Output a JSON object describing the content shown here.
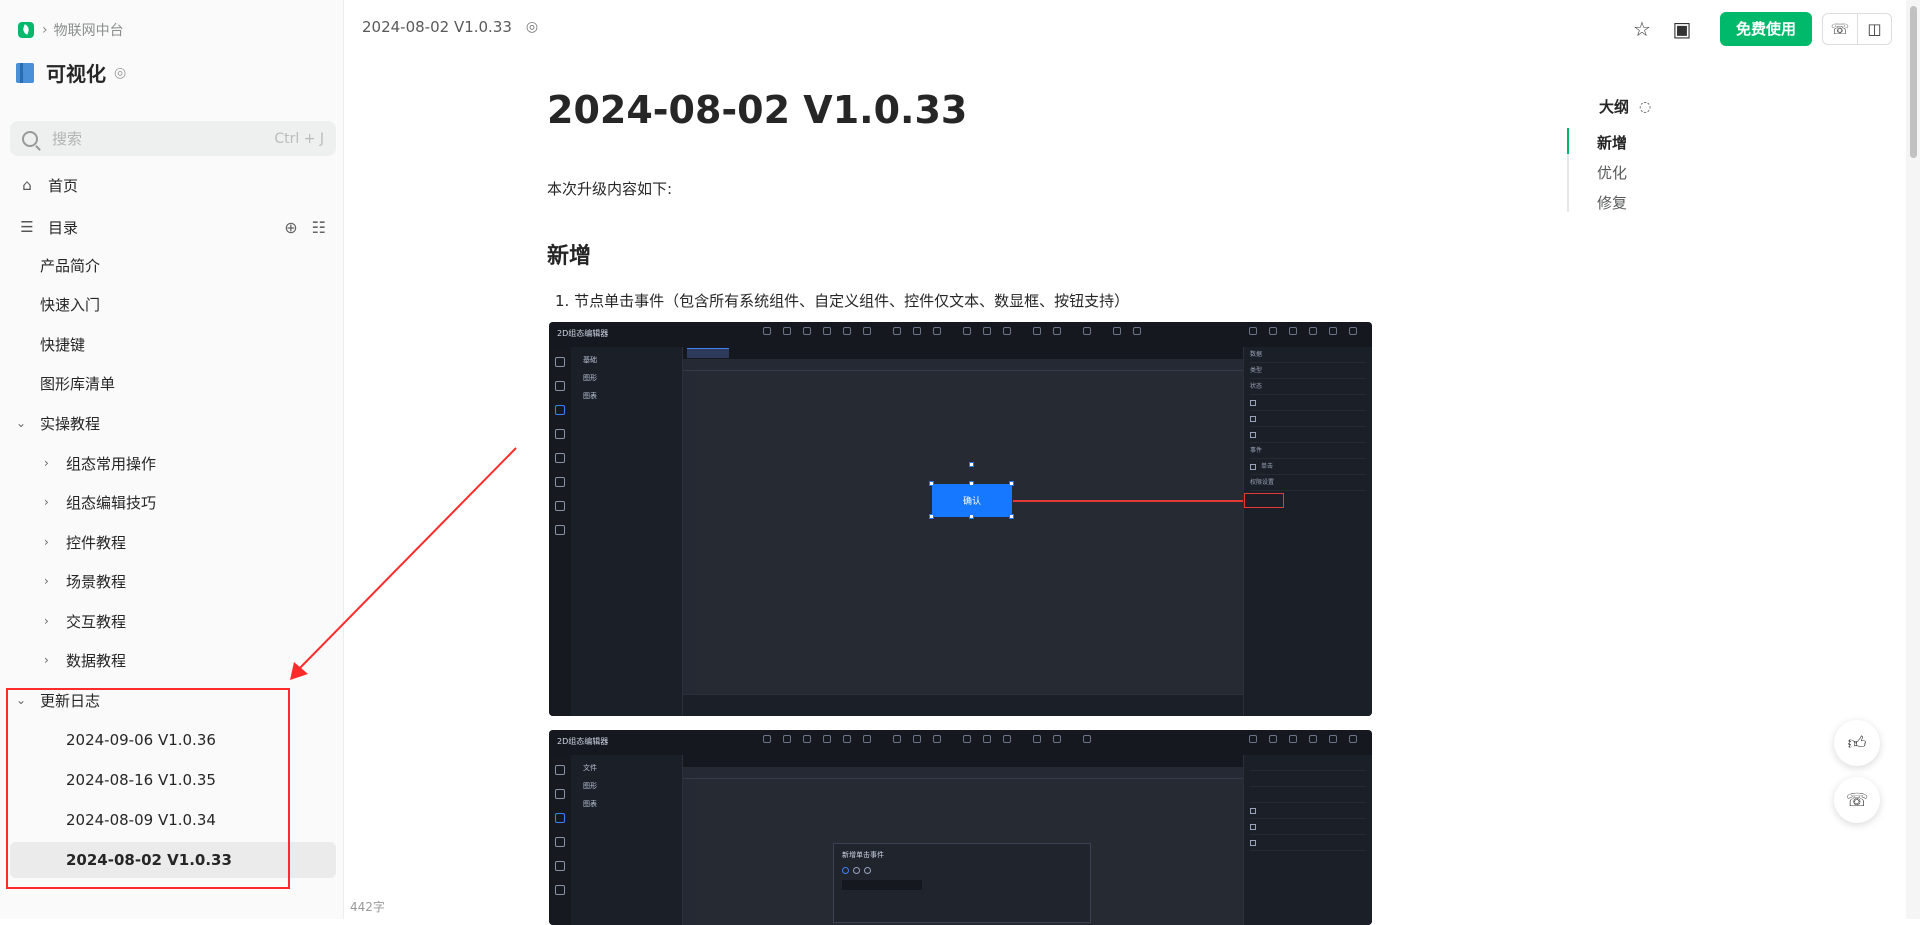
{
  "breadcrumb": {
    "parent": "物联网中台"
  },
  "book": {
    "title": "可视化"
  },
  "search": {
    "placeholder": "搜索",
    "shortcut": "Ctrl + J"
  },
  "nav": {
    "home": "首页",
    "catalog": "目录",
    "items": [
      "产品简介",
      "快速入门",
      "快捷键",
      "图形库清单"
    ],
    "tutorial": {
      "label": "实操教程",
      "children": [
        "组态常用操作",
        "组态编辑技巧",
        "控件教程",
        "场景教程",
        "交互教程",
        "数据教程"
      ]
    },
    "changelog": {
      "label": "更新日志",
      "children": [
        "2024-09-06 V1.0.36",
        "2024-08-16 V1.0.35",
        "2024-08-09 V1.0.34",
        "2024-08-02 V1.0.33"
      ]
    }
  },
  "word_count": "442字",
  "header": {
    "doc_title": "2024-08-02 V1.0.33",
    "free_button": "免费使用"
  },
  "doc": {
    "title": "2024-08-02 V1.0.33",
    "intro": "本次升级内容如下:",
    "section_new": "新增",
    "list_item_1": "1. 节点单击事件（包含所有系统组件、自定义组件、控件仅文本、数显框、按钮支持）"
  },
  "screenshot1": {
    "app_title": "2D组态编辑器",
    "tree": [
      "基础",
      "图形",
      "图表"
    ],
    "button_label": "确认",
    "panel_rows": [
      "数据",
      "类型",
      "状态",
      "事件",
      "单击",
      "权限设置"
    ]
  },
  "screenshot2": {
    "app_title": "2D组态编辑器",
    "tree": [
      "文件",
      "图形",
      "图表"
    ],
    "dialog_title": "新增单击事件"
  },
  "outline": {
    "title": "大纲",
    "items": [
      "新增",
      "优化",
      "修复"
    ]
  },
  "colors": {
    "accent": "#00b96b",
    "highlight": "#ff2b2b"
  }
}
